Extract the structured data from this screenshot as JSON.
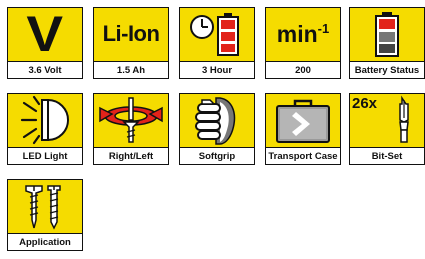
{
  "icons": [
    {
      "caption": "3.6 Volt",
      "symbol": "V",
      "icon": "voltage-icon"
    },
    {
      "caption": "1.5 Ah",
      "symbol": "Li-Ion",
      "icon": "battery-type-icon"
    },
    {
      "caption": "3 Hour",
      "icon": "charging-time-icon"
    },
    {
      "caption": "200",
      "symbol": "min",
      "symbol_sup": "-1",
      "icon": "rpm-icon"
    },
    {
      "caption": "Battery Status",
      "icon": "battery-status-icon"
    },
    {
      "caption": "LED Light",
      "icon": "led-light-icon"
    },
    {
      "caption": "Right/Left",
      "icon": "rotation-direction-icon"
    },
    {
      "caption": "Softgrip",
      "icon": "softgrip-icon"
    },
    {
      "caption": "Transport Case",
      "icon": "transport-case-icon"
    },
    {
      "caption": "Bit-Set",
      "symbol": "26x",
      "icon": "bit-set-icon"
    },
    {
      "caption": "Application",
      "icon": "screws-icon"
    }
  ],
  "colors": {
    "tile_yellow": "#f5dc00",
    "outline": "#111111",
    "battery_red": "#e2231a",
    "arrow_red": "#e2231a",
    "case_grey": "#9a9a9a"
  }
}
